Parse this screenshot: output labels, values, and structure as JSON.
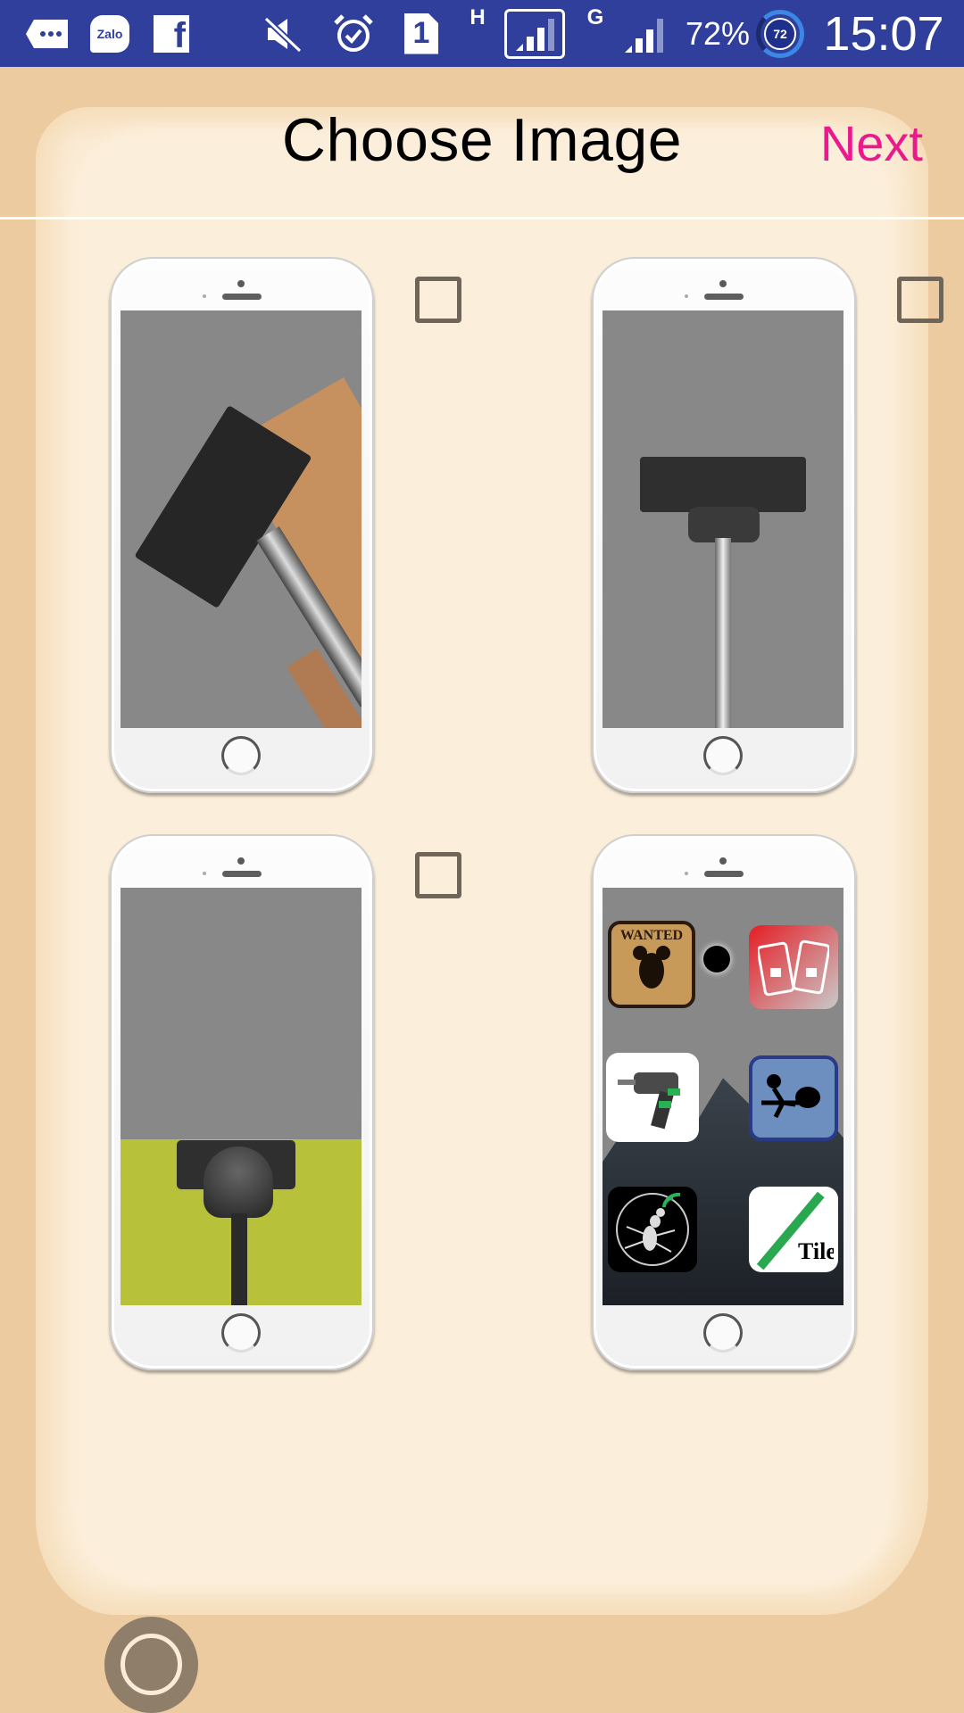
{
  "status_bar": {
    "left_icons": [
      "messages-icon",
      "zalo-icon",
      "facebook-icon"
    ],
    "zalo_label": "Zalo",
    "facebook_label": "f",
    "right_icons": [
      "mute-icon",
      "alarm-icon",
      "sim1-icon",
      "signal-icon",
      "signal-icon"
    ],
    "sim_label": "1",
    "network_h": "H",
    "network_g": "G",
    "battery_percent": "72%",
    "battery_badge": "72",
    "time": "15:07",
    "colors": {
      "background": "#2f3f9b",
      "foreground": "#ffffff"
    }
  },
  "header": {
    "title": "Choose Image",
    "next_label": "Next",
    "colors": {
      "next": "#ea1a8d",
      "title": "#000000"
    }
  },
  "images": [
    {
      "name": "Vacuum on money and cork floor",
      "checkbox_visible": true,
      "checked": false
    },
    {
      "name": "Vacuum on teal carpet",
      "checkbox_visible": true,
      "checked": false
    },
    {
      "name": "Vacuum on green carpet",
      "checkbox_visible": true,
      "checked": false
    },
    {
      "name": "App icons on dark mountain background",
      "checkbox_visible": false,
      "checked": false,
      "app_icons": [
        {
          "label": "WANTED",
          "icon": "wanted-rat-icon"
        },
        {
          "label": "",
          "icon": "phone-lock-icon"
        },
        {
          "label": "",
          "icon": "drill-icon"
        },
        {
          "label": "",
          "icon": "pocket-stickman-icon"
        },
        {
          "label": "",
          "icon": "ant-signal-icon"
        },
        {
          "label": "",
          "icon": "level-ruler-icon"
        }
      ]
    }
  ],
  "fab": {
    "icon": "circle-icon"
  },
  "colors": {
    "background": "#ebcb9f",
    "paper": "#fbecd6",
    "checkbox_border": "#6f6558",
    "fab": "#8f7e69"
  }
}
